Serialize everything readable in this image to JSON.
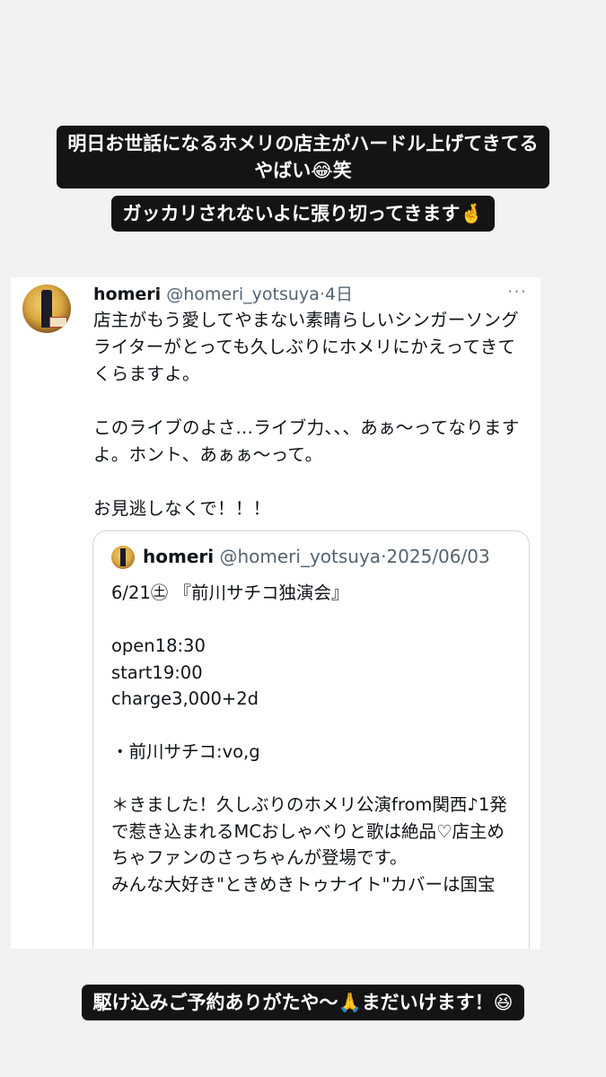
{
  "story": {
    "caption_top_line1": "明日お世話になるホメリの店主がハードル上げてきてる",
    "caption_top_line2": "やばい😂笑",
    "caption_middle": "ガッカリされないよに張り切ってきます🤞",
    "caption_bottom": "駆け込みご予約ありがたや〜🙏まだいけます！😆"
  },
  "tweet": {
    "display_name": "homeri",
    "handle": "@homeri_yotsuya",
    "separator": "·",
    "age": "4日",
    "more_icon": "···",
    "body": "店主がもう愛してやまない素晴らしいシンガーソングライターがとっても久しぶりにホメリにかえってきてくらますよ。\n\nこのライブのよさ…ライブ力、、、あぁ〜ってなりますよ。ホント、あぁぁ〜って。\n\nお見逃しなくで！！！"
  },
  "quote": {
    "display_name": "homeri",
    "handle": "@homeri_yotsuya",
    "separator": "·",
    "date": "2025/06/03",
    "body": "6/21㊏ 『前川サチコ独演会』\n\nopen18:30\nstart19:00\ncharge3,000+2d\n\n・前川サチコ:vo,g\n\n＊きました！久しぶりのホメリ公演from関西♪1発で惹き込まれるMCおしゃべりと歌は絶品♡店主めちゃファンのさっちゃんが登場です。\nみんな大好き\"ときめきトゥナイト\"カバーは国宝"
  }
}
